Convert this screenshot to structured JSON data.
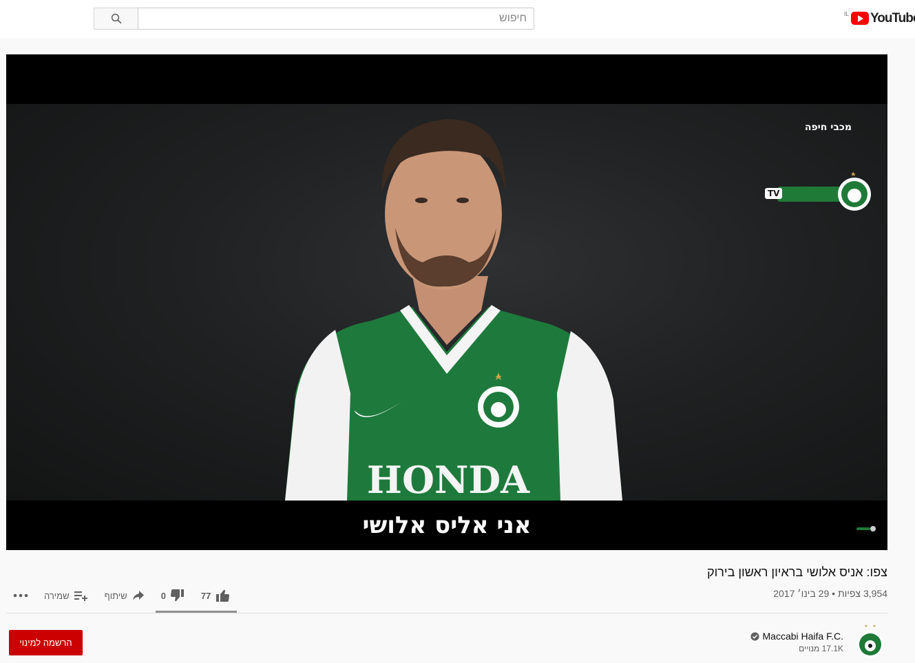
{
  "header": {
    "search_placeholder": "חיפוש",
    "logo_text": "YouTube",
    "country_code": "IL",
    "icons": [
      "search-icon",
      "youtube-logo-icon"
    ]
  },
  "video": {
    "subtitle": "אני אליס אלושי",
    "overlay_channel_text": "מכבי חיפה",
    "overlay_tv": "TV",
    "jersey_sponsor": "HONDA"
  },
  "info": {
    "title": "צפו: אניס אלושי בראיון ראשון בירוק",
    "views": "3,954 צפיות",
    "separator": " • ",
    "date": "29 בינו׳ 2017",
    "likes": "77",
    "dislikes": "0",
    "share_label": "שיתוף",
    "save_label": "שמירה",
    "like_ratio": 1.0
  },
  "channel": {
    "name": "Maccabi Haifa F.C.",
    "subscribers": "17.1K מנויים",
    "subscribe_label": "הרשמה למינוי",
    "verified": true
  },
  "colors": {
    "brand_red": "#ff0000",
    "subscribe_red": "#cc0000",
    "jersey_green": "#1e7a3c"
  }
}
